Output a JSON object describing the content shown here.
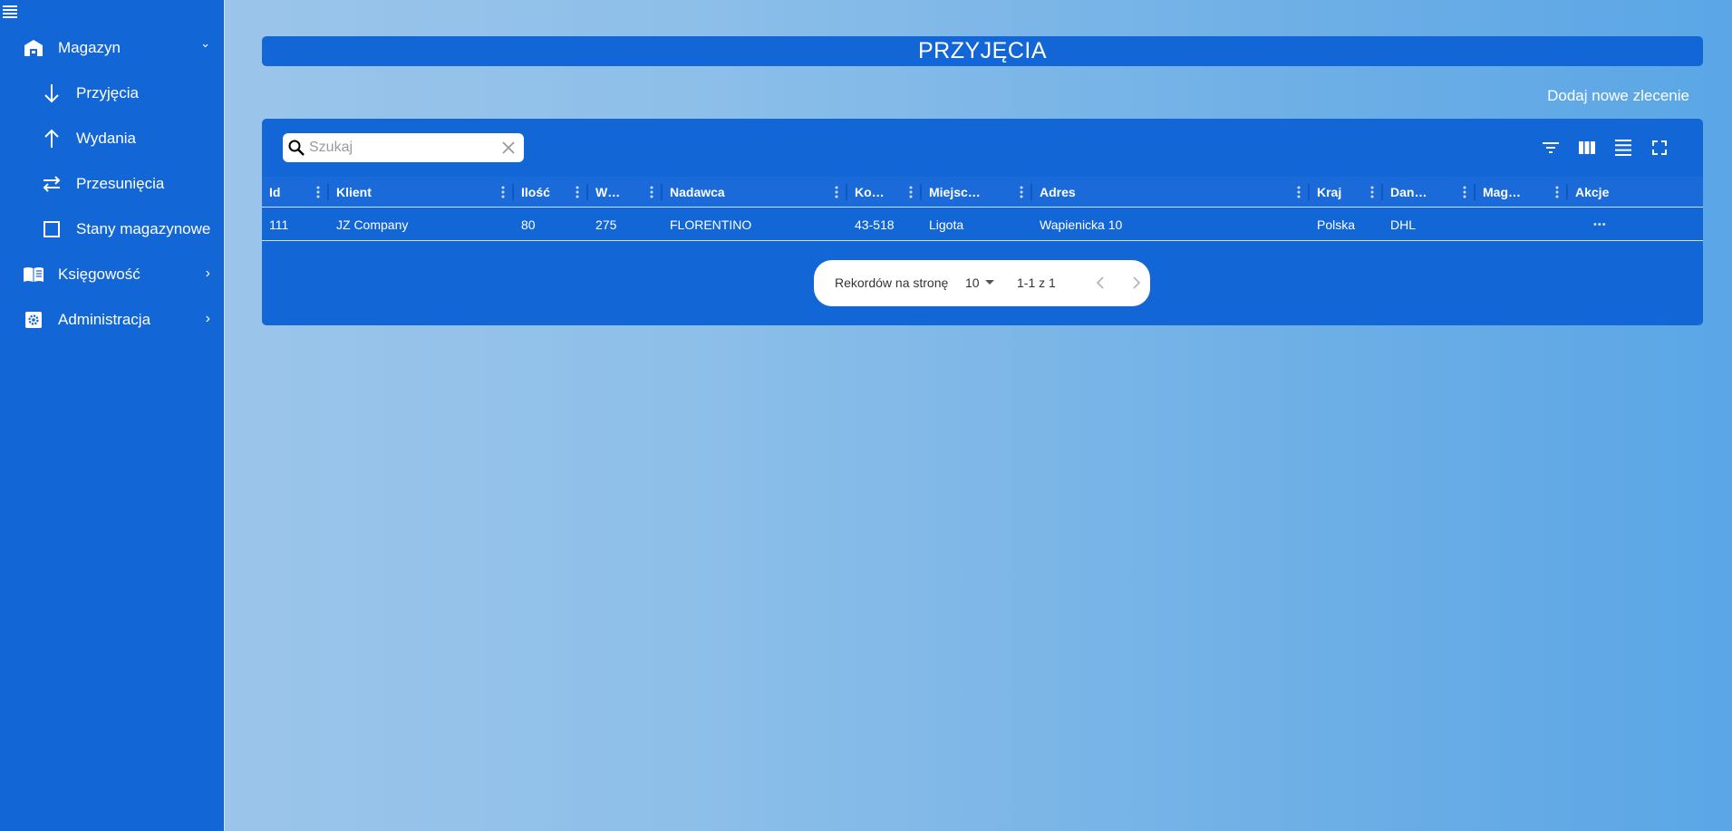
{
  "sidebar": {
    "items": [
      {
        "label": "Magazyn",
        "icon": "warehouse-icon",
        "chevron": "⌄"
      },
      {
        "label": "Przyjęcia",
        "icon": "arrow-down-icon"
      },
      {
        "label": "Wydania",
        "icon": "arrow-up-icon"
      },
      {
        "label": "Przesunięcia",
        "icon": "swap-icon"
      },
      {
        "label": "Stany magazynowe",
        "icon": "square-icon"
      },
      {
        "label": "Księgowość",
        "icon": "book-icon",
        "chevron": "›"
      },
      {
        "label": "Administracja",
        "icon": "settings-icon",
        "chevron": "›"
      }
    ]
  },
  "page": {
    "title": "PRZYJĘCIA",
    "add_label": "Dodaj nowe zlecenie"
  },
  "search": {
    "placeholder": "Szukaj"
  },
  "table": {
    "columns": [
      "Id",
      "Klient",
      "Ilość",
      "W…",
      "Nadawca",
      "Ko…",
      "Miejsc…",
      "Adres",
      "Kraj",
      "Dan…",
      "Mag…",
      "Akcje"
    ],
    "rows": [
      {
        "cells": [
          "111",
          "JZ Company",
          "80",
          "275",
          "FLORENTINO",
          "43-518",
          "Ligota",
          "Wapienicka 10",
          "Polska",
          "DHL",
          "",
          "•••"
        ]
      }
    ]
  },
  "pagination": {
    "rows_per_page_label": "Rekordów na stronę",
    "rows_per_page": "10",
    "range": "1-1 z 1"
  },
  "colors": {
    "primary": "#1366d6",
    "accent": "#5aa6e6"
  }
}
